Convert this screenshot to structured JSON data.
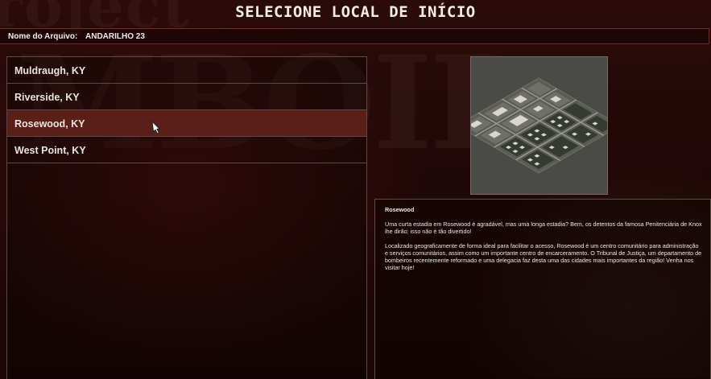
{
  "title": "SELECIONE LOCAL DE INÍCIO",
  "file": {
    "label": "Nome do Arquivo:",
    "value": "ANDARILHO 23"
  },
  "locations": [
    {
      "label": "Muldraugh, KY",
      "selected": false
    },
    {
      "label": "Riverside, KY",
      "selected": false
    },
    {
      "label": "Rosewood, KY",
      "selected": true
    },
    {
      "label": "West Point, KY",
      "selected": false
    }
  ],
  "description": {
    "title": "Rosewood",
    "paragraph1": "Uma curta estadia em Rosewood é agradável, mas uma longa estadia? Bem, os detentos da famosa Penitenciária de Knox lhe dirão: isso não é tão divertido!",
    "paragraph2": "Localizado geograficamente de forma ideal para facilitar o acesso, Rosewood é um centro comunitário para administração e serviços comunitários, assim como um importante centro de encarceramento. O Tribunal de Justiça, um departamento de bombeiros recentemente reformado e uma delegacia faz desta uma das cidades mais importantes da região! Venha nos visitar hoje!"
  },
  "background_watermark": {
    "line1": "roject",
    "line2": "MBOID"
  },
  "colors": {
    "selected_row": "#5a1f16",
    "border_red": "#6e2a26",
    "background": "#1a0707"
  }
}
